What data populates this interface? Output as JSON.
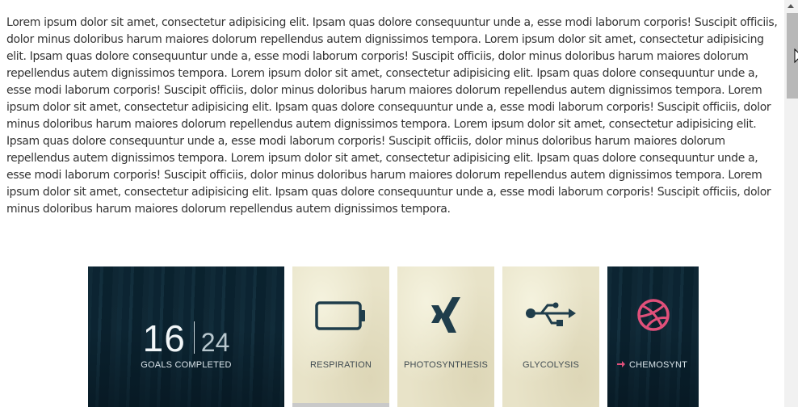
{
  "content": {
    "lorem_text": "Lorem ipsum dolor sit amet, consectetur adipisicing elit. Ipsam quas dolore consequuntur unde a, esse modi laborum corporis! Suscipit officiis, dolor minus doloribus harum maiores dolorum repellendus autem dignissimos tempora. Lorem ipsum dolor sit amet, consectetur adipisicing elit. Ipsam quas dolore consequuntur unde a, esse modi laborum corporis! Suscipit officiis, dolor minus doloribus harum maiores dolorum repellendus autem dignissimos tempora. Lorem ipsum dolor sit amet, consectetur adipisicing elit. Ipsam quas dolore consequuntur unde a, esse modi laborum corporis! Suscipit officiis, dolor minus doloribus harum maiores dolorum repellendus autem dignissimos tempora. Lorem ipsum dolor sit amet, consectetur adipisicing elit. Ipsam quas dolore consequuntur unde a, esse modi laborum corporis! Suscipit officiis, dolor minus doloribus harum maiores dolorum repellendus autem dignissimos tempora. Lorem ipsum dolor sit amet, consectetur adipisicing elit. Ipsam quas dolore consequuntur unde a, esse modi laborum corporis! Suscipit officiis, dolor minus doloribus harum maiores dolorum repellendus autem dignissimos tempora. Lorem ipsum dolor sit amet, consectetur adipisicing elit. Ipsam quas dolore consequuntur unde a, esse modi laborum corporis! Suscipit officiis, dolor minus doloribus harum maiores dolorum repellendus autem dignissimos tempora. Lorem ipsum dolor sit amet, consectetur adipisicing elit. Ipsam quas dolore consequuntur unde a, esse modi laborum corporis! Suscipit officiis, dolor minus doloribus harum maiores dolorum repellendus autem dignissimos tempora."
  },
  "tiles": {
    "goals": {
      "completed": "16",
      "total": "24",
      "label": "GOALS COMPLETED",
      "icon": "none"
    },
    "respiration": {
      "label": "RESPIRATION",
      "icon": "battery-icon",
      "icon_color": "#1f3d4b"
    },
    "photosynthesis": {
      "label": "PHOTOSYNTHESIS",
      "icon": "xing-icon",
      "icon_color": "#1f3d4b"
    },
    "glycolysis": {
      "label": "GLYCOLYSIS",
      "icon": "usb-icon",
      "icon_color": "#1f3d4b"
    },
    "chemosynt": {
      "label": "CHEMOSYNT",
      "icon": "dribbble-icon",
      "icon_color": "#e0507a",
      "arrow_icon": "arrow-right-icon",
      "arrow_color": "#e0507a"
    }
  }
}
